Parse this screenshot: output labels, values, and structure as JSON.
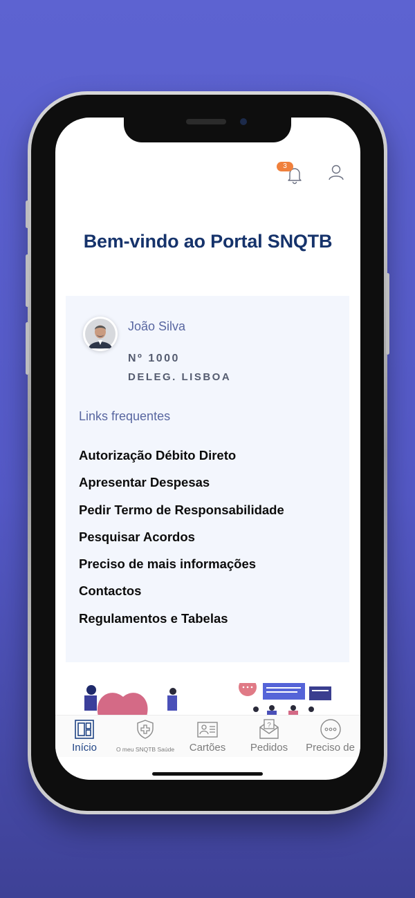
{
  "header": {
    "notification_count": "3",
    "welcome": "Bem-vindo ao Portal SNQTB"
  },
  "profile": {
    "name": "João Silva",
    "member_number": "Nº 1000",
    "delegation": "DELEG. LISBOA"
  },
  "links": {
    "heading": "Links frequentes",
    "items": [
      "Autorização Débito Direto",
      "Apresentar Despesas",
      "Pedir Termo de Responsabilidade",
      "Pesquisar Acordos",
      "Preciso de mais informações",
      "Contactos",
      "Regulamentos e Tabelas"
    ]
  },
  "tabbar": {
    "tabs": [
      {
        "label": "Início",
        "icon": "home-grid-icon",
        "active": true
      },
      {
        "label": "O meu SNQTB Saúde",
        "icon": "health-shield-icon"
      },
      {
        "label": "Cartões",
        "icon": "id-card-icon"
      },
      {
        "label": "Pedidos",
        "icon": "envelope-question-icon"
      },
      {
        "label": "Preciso de",
        "icon": "more-dots-icon"
      }
    ]
  },
  "colors": {
    "background": "#5d63d1",
    "title": "#16336b",
    "accent_label": "#5866a0",
    "badge": "#f0803c",
    "card": "#f3f6fd",
    "active_tab": "#1f4384"
  }
}
